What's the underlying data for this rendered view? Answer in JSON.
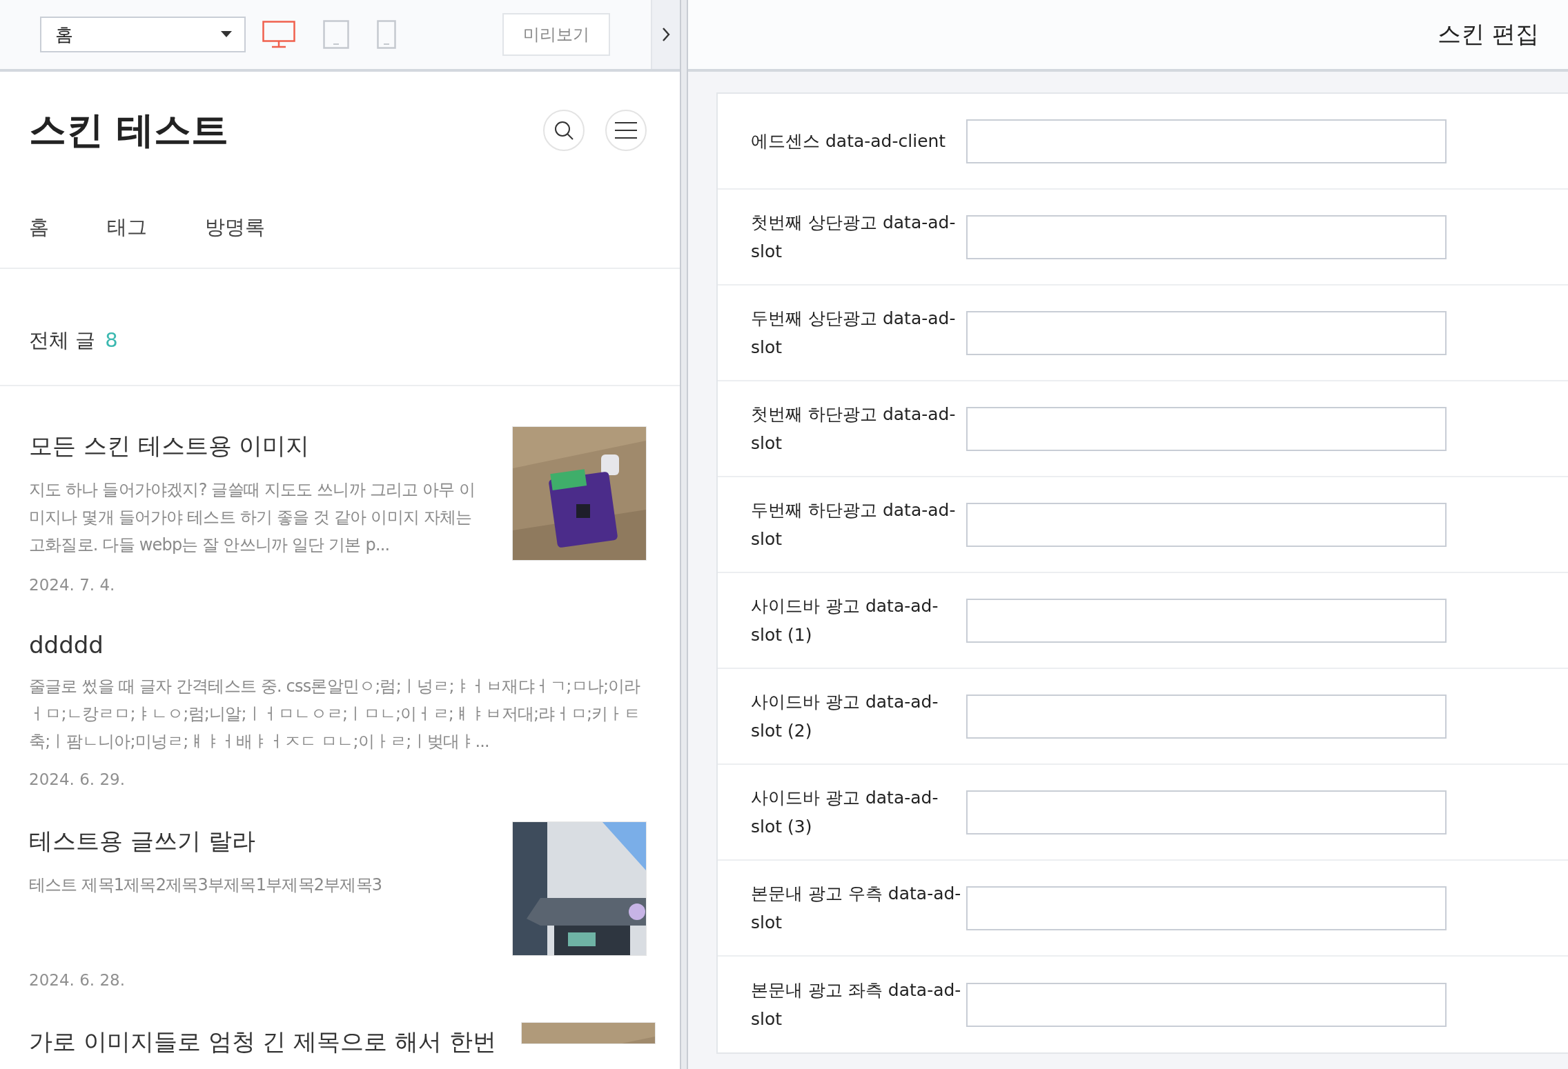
{
  "toolbar": {
    "page_select": "홈",
    "devices": [
      {
        "kind": "desktop",
        "selected": true
      },
      {
        "kind": "tablet",
        "selected": false
      },
      {
        "kind": "mobile",
        "selected": false
      }
    ],
    "preview_button": "미리보기"
  },
  "blog": {
    "title": "스킨 테스트",
    "nav": [
      "홈",
      "태그",
      "방명록"
    ],
    "section_title": "전체 글",
    "post_count": "8",
    "posts": [
      {
        "title": "모든 스킨 테스트용 이미지",
        "excerpt": "지도 하나 들어가야겠지?  글쓸때 지도도 쓰니까  그리고 아무 이미지나 몇개 들어가야 테스트 하기 좋을 것 같아 이미지 자체는 고화질로. 다들 webp는 잘 안쓰니까  일단 기본 p...",
        "date": "2024. 7. 4.",
        "thumbnail": true
      },
      {
        "title": "ddddd",
        "excerpt": "줄글로 썼을 때 글자 간격테스트 중. css론알민ㅇ;럼;ㅣ넝ㄹ;ㅑㅓㅂ재댜ㅓㄱ;ㅁ나;이라ㅓㅁ;ㄴ캉ㄹㅁ;ㅑㄴㅇ;럼;니알;ㅣㅓㅁㄴㅇㄹ;ㅣㅁㄴ;이ㅓㄹ;ㅒㅑㅂ저대;랴ㅓㅁ;키ㅏㅌ축;ㅣ팜ㄴ니아;미넝ㄹ;ㅒㅑㅓ배ㅑㅓㅈㄷ ㅁㄴ;이ㅏㄹ;ㅣ벚대ㅑ...",
        "date": "2024. 6. 29.",
        "thumbnail": false
      },
      {
        "title": "테스트용 글쓰기 랄라",
        "excerpt": "테스트 제목1제목2제목3부제목1부제목2부제목3",
        "date": "2024. 6. 28.",
        "thumbnail": true
      },
      {
        "title": "가로 이미지들로 엄청 긴 제목으로 해서 한번",
        "thumbnail": true
      }
    ]
  },
  "editor": {
    "title": "스킨 편집",
    "fields": [
      {
        "label": "에드센스 data-ad-client"
      },
      {
        "label": "첫번째 상단광고 data-ad-slot"
      },
      {
        "label": "두번째 상단광고 data-ad-slot"
      },
      {
        "label": "첫번째 하단광고 data-ad-slot"
      },
      {
        "label": "두번째 하단광고 data-ad-slot"
      },
      {
        "label": "사이드바 광고 data-ad-slot (1)"
      },
      {
        "label": "사이드바 광고 data-ad-slot (2)"
      },
      {
        "label": "사이드바 광고 data-ad-slot (3)"
      },
      {
        "label": "본문내 광고 우측 data-ad-slot"
      },
      {
        "label": "본문내 광고 좌측 data-ad-slot"
      }
    ]
  }
}
